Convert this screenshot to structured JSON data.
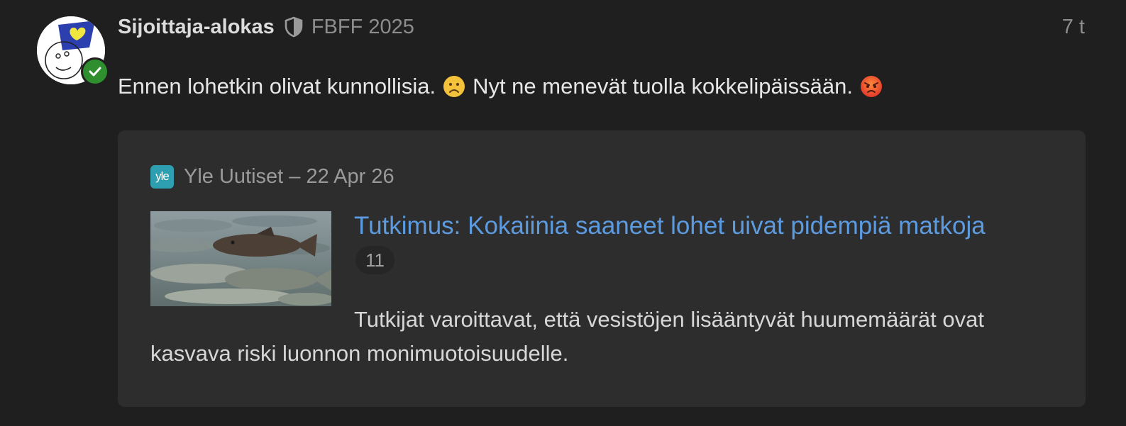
{
  "post": {
    "username": "Sijoittaja-alokas",
    "flair": "FBFF 2025",
    "time": "7 t",
    "text_part1": "Ennen lohetkin olivat kunnollisia.",
    "text_part2": "Nyt ne menevät tuolla kokkelipäissään.",
    "emoji1": "frowning-face-emoji",
    "emoji2": "angry-face-emoji"
  },
  "link_card": {
    "source_icon": "yle",
    "source": "Yle Uutiset – 22 Apr 26",
    "title": "Tutkimus: Kokaiinia saaneet lohet uivat pidempiä matkoja",
    "clicks": "11",
    "excerpt": "Tutkijat varoittavat, että vesistöjen lisääntyvät huumemäärät ovat kasvava riski luonnon monimuotoisuudelle."
  },
  "colors": {
    "background": "#1f1f1f",
    "card": "#2d2d2d",
    "link": "#5d9be0",
    "verified": "#2f8f2f",
    "yle": "#2e9fb0"
  }
}
